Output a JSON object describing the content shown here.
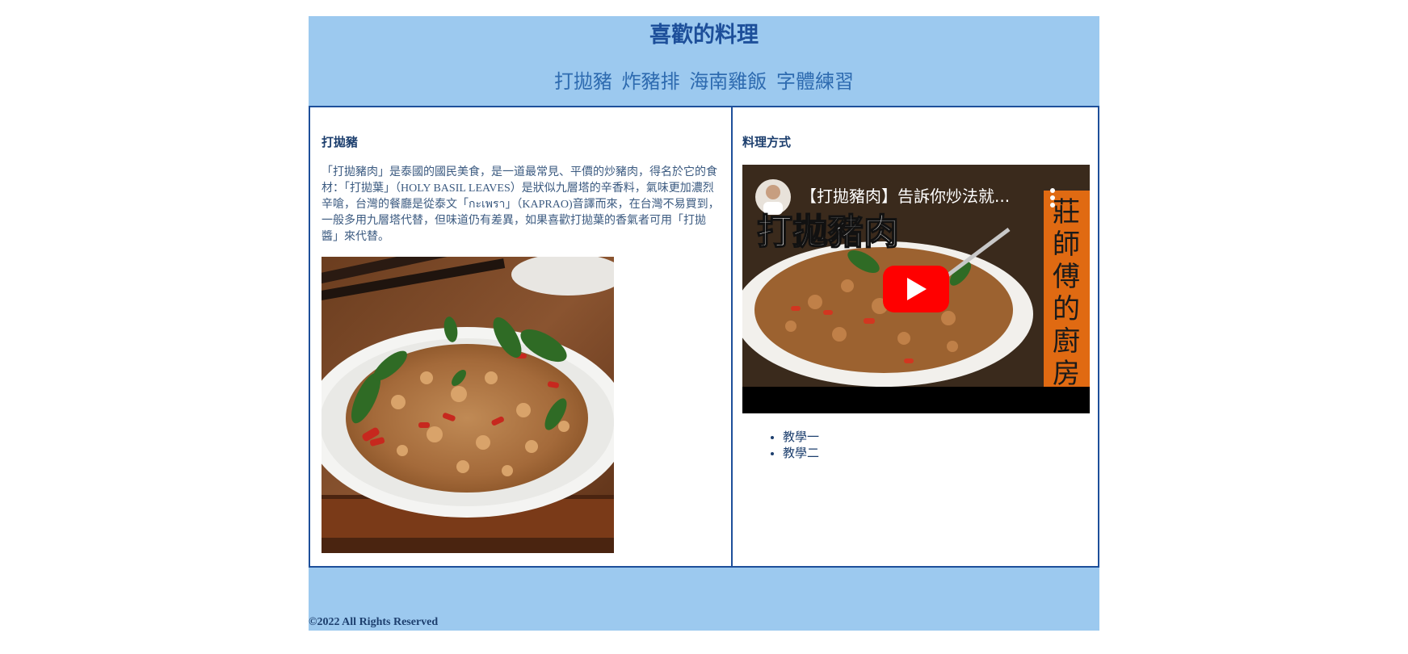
{
  "header": {
    "title": "喜歡的料理",
    "nav": [
      "打拋豬",
      "炸豬排",
      "海南雞飯",
      "字體練習"
    ]
  },
  "left": {
    "heading": "打拋豬",
    "description": "「打拋豬肉」是泰國的國民美食，是一道最常見、平價的炒豬肉，得名於它的食材：「打拋葉」（HOLY BASIL LEAVES）是狀似九層塔的辛香料，氣味更加濃烈辛嗆，台灣的餐廳是從泰文「กะเพรา」（KAPRAO)音譯而來，在台灣不易買到，一般多用九層塔代替，但味道仍有差異，如果喜歡打拋葉的香氣者可用「打拋醬」來代替。"
  },
  "right": {
    "heading": "料理方式",
    "video": {
      "title": "【打拋豬肉】告訴你炒法就...",
      "overlay_text": "打拋豬肉",
      "side_banner": "莊師傅的廚房"
    },
    "tutorials": [
      "教學一",
      "教學二"
    ]
  },
  "footer": {
    "copyright": "©2022 All Rights Reserved"
  },
  "colors": {
    "band": "#9cc9ef",
    "border": "#1d4f9a",
    "title": "#1d4f9a",
    "nav": "#2e6bb0"
  }
}
